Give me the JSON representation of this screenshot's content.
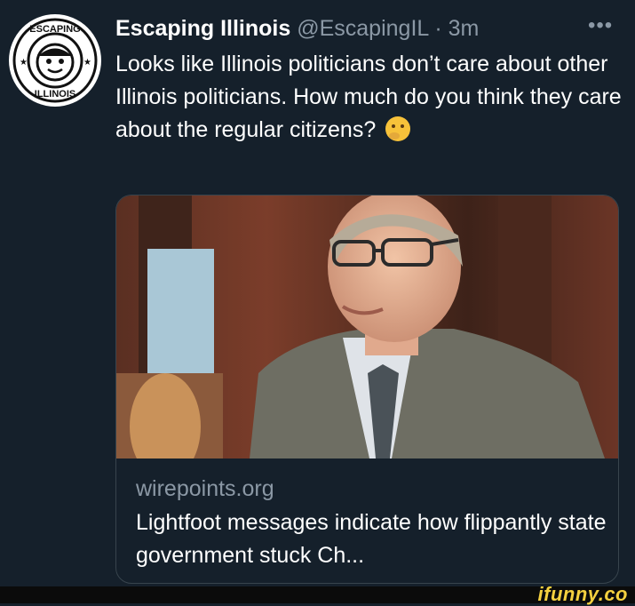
{
  "tweet": {
    "author_name": "Escaping Illinois",
    "handle": "@EscapingIL",
    "separator": "·",
    "time": "3m",
    "more_label": "•••",
    "text": "Looks like Illinois politicians don’t care about other Illinois politicians. How much do you think they care about the regular citizens?",
    "emoji": "thinking-face",
    "avatar_logo_text": [
      "ESCAPING",
      "ILLINOIS"
    ]
  },
  "card": {
    "domain": "wirepoints.org",
    "title": "Lightfoot messages indicate how flippantly state government stuck Ch..."
  },
  "watermark": "ifunny.co",
  "colors": {
    "background": "#15202b",
    "secondary_text": "#8b98a5",
    "border": "#38444d",
    "watermark": "#f4d03f"
  }
}
